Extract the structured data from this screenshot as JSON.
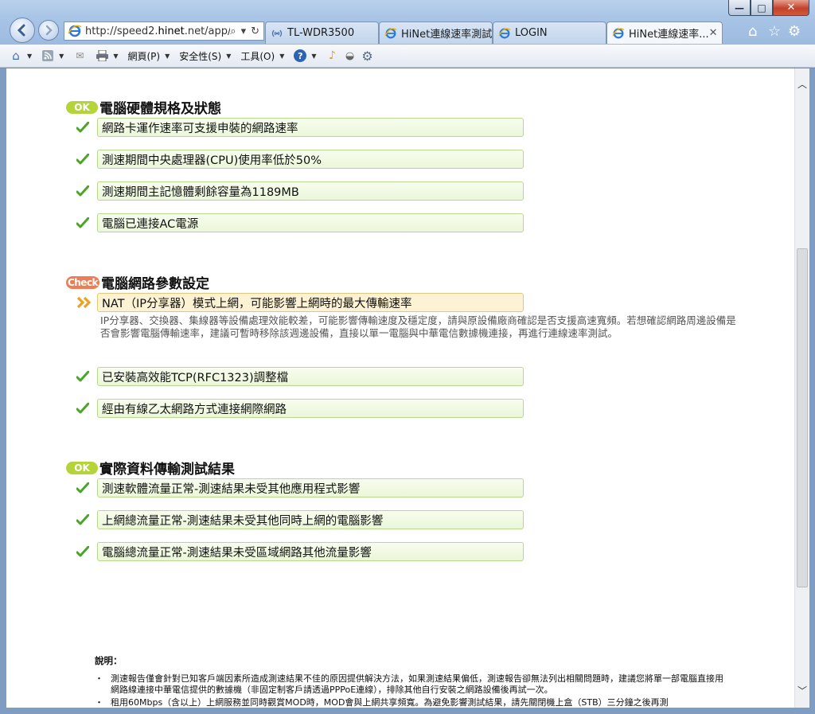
{
  "browser": {
    "address_url": "http://speed2.",
    "address_url_host": "hinet",
    "address_url_rest": ".net/app/s",
    "tabs": [
      {
        "label": "TL-WDR3500"
      },
      {
        "label": "HiNet連線速率測試"
      },
      {
        "label": "LOGIN"
      },
      {
        "label": "HiNet連線速率..."
      }
    ],
    "window_buttons": {
      "minimize": "—",
      "maximize": "□",
      "close": "✕"
    },
    "command_bar": {
      "page": "網頁(P)",
      "safety": "安全性(S)",
      "tools": "工具(O)",
      "help": "?"
    },
    "accent_color": "#3e5f8c"
  },
  "sections": [
    {
      "badge": "OK",
      "title": "電腦硬體規格及狀態",
      "items": [
        {
          "text": "網路卡運作速率可支援申裝的網路速率"
        },
        {
          "text": "測速期間中央處理器(CPU)使用率低於50%"
        },
        {
          "text": "測速期間主記憶體剩餘容量為1189MB"
        },
        {
          "text": "電腦已連接AC電源"
        }
      ]
    },
    {
      "badge": "Check",
      "title": "電腦網路參數設定",
      "warning": {
        "text": "NAT（IP分享器）模式上網，可能影響上網時的最大傳輸速率",
        "description": "IP分享器、交換器、集線器等設備處理效能較差，可能影響傳輸速度及穩定度，請與原設備廠商確認是否支援高速寬頻。若想確認網路周邊設備是否會影響電腦傳輸速率，建議可暫時移除該週邊設備，直接以單一電腦與中華電信數據機連接，再進行連線速率測試。"
      },
      "items": [
        {
          "text": "已安裝高效能TCP(RFC1323)調整檔"
        },
        {
          "text": "經由有線乙太網路方式連接網際網路"
        }
      ]
    },
    {
      "badge": "OK",
      "title": "實際資料傳輸測試結果",
      "items": [
        {
          "text": "測速軟體流量正常-測速結果未受其他應用程式影響"
        },
        {
          "text": "上網總流量正常-測速結果未受其他同時上網的電腦影響"
        },
        {
          "text": "電腦總流量正常-測速結果未受區域網路其他流量影響"
        }
      ]
    }
  ],
  "notes": {
    "title": "說明：",
    "items": [
      "測速報告僅會針對已知客戶端因素所造成測速結果不佳的原因提供解決方法，如果測速結果偏低，測速報告卻無法列出相關問題時，建議您將單一部電腦直接用網路線連接中華電信提供的數據機（非固定制客戶請透過PPPoE連線），排除其他自行安裝之網路設備後再試一次。",
      "租用60Mbps（含以上）上網服務並同時觀賞MOD時，MOD會與上網共享頻寬。為避免影響測試結果，請先關閉機上盒（STB）三分鐘之後再測"
    ]
  },
  "colors": {
    "ok_badge": "#b4d43a",
    "check_badge": "#ec7d55",
    "checkmark": "#4aa52a",
    "warn_arrow": "#f0a020"
  }
}
